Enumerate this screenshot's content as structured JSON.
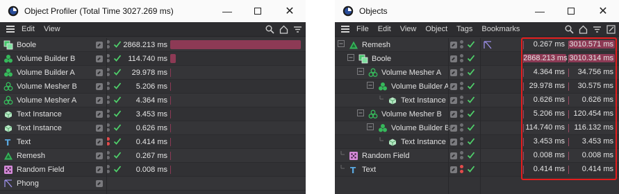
{
  "profiler": {
    "title": "Object Profiler (Total Time 3027.269 ms)",
    "menu": [
      "Edit",
      "View"
    ],
    "total_ms": 3027.269,
    "rows": [
      {
        "name": "Boole",
        "icon": "boole-icon",
        "time": "2868.213 ms",
        "ms": 2868.213,
        "dots": "grey"
      },
      {
        "name": "Volume Builder B",
        "icon": "volume-builder-icon",
        "time": "114.740 ms",
        "ms": 114.74,
        "dots": "grey"
      },
      {
        "name": "Volume Builder A",
        "icon": "volume-builder-icon",
        "time": "29.978 ms",
        "ms": 29.978,
        "dots": "grey"
      },
      {
        "name": "Volume Mesher  B",
        "icon": "volume-mesher-icon",
        "time": "5.206 ms",
        "ms": 5.206,
        "dots": "grey"
      },
      {
        "name": "Volume Mesher A",
        "icon": "volume-mesher-icon",
        "time": "4.364 ms",
        "ms": 4.364,
        "dots": "grey"
      },
      {
        "name": "Text Instance",
        "icon": "instance-icon",
        "time": "3.453 ms",
        "ms": 3.453,
        "dots": "grey"
      },
      {
        "name": "Text Instance",
        "icon": "instance-icon",
        "time": "0.626 ms",
        "ms": 0.626,
        "dots": "grey"
      },
      {
        "name": "Text",
        "icon": "text-spline-icon",
        "time": "0.414 ms",
        "ms": 0.414,
        "dots": "red"
      },
      {
        "name": "Remesh",
        "icon": "remesh-icon",
        "time": "0.267 ms",
        "ms": 0.267,
        "dots": "grey"
      },
      {
        "name": "Random Field",
        "icon": "random-field-icon",
        "time": "0.008 ms",
        "ms": 0.008,
        "dots": "grey"
      },
      {
        "name": "Phong",
        "icon": "phong-tag-icon",
        "time": "",
        "ms": 0,
        "dots": "none"
      }
    ]
  },
  "objects": {
    "title": "Objects",
    "menu": [
      "File",
      "Edit",
      "View",
      "Object",
      "Tags",
      "Bookmarks"
    ],
    "rows": [
      {
        "name": "Remesh",
        "icon": "remesh-icon",
        "depth": 0,
        "expand": "−",
        "tag": "phong-tag-icon",
        "self": "0.267 ms",
        "total": "3010.571 ms",
        "self_hl": false,
        "total_hl": true,
        "dots": "grey"
      },
      {
        "name": "Boole",
        "icon": "boole-icon",
        "depth": 1,
        "expand": "−",
        "tag": "",
        "self": "2868.213 ms",
        "total": "3010.314 ms",
        "self_hl": true,
        "total_hl": true,
        "dots": "grey"
      },
      {
        "name": "Volume Mesher A",
        "icon": "volume-mesher-icon",
        "depth": 2,
        "expand": "−",
        "tag": "",
        "self": "4.364 ms",
        "total": "34.756 ms",
        "self_hl": false,
        "total_hl": false,
        "dots": "grey"
      },
      {
        "name": "Volume Builder A",
        "icon": "volume-builder-icon",
        "depth": 3,
        "expand": "−",
        "tag": "",
        "self": "29.978 ms",
        "total": "30.575 ms",
        "self_hl": false,
        "total_hl": false,
        "dots": "grey"
      },
      {
        "name": "Text Instance",
        "icon": "instance-icon",
        "depth": 4,
        "expand": "",
        "tag": "",
        "self": "0.626 ms",
        "total": "0.626 ms",
        "self_hl": false,
        "total_hl": false,
        "dots": "grey"
      },
      {
        "name": "Volume Mesher  B",
        "icon": "volume-mesher-icon",
        "depth": 2,
        "expand": "−",
        "tag": "",
        "self": "5.206 ms",
        "total": "120.454 ms",
        "self_hl": false,
        "total_hl": false,
        "dots": "grey"
      },
      {
        "name": "Volume Builder B",
        "icon": "volume-builder-icon",
        "depth": 3,
        "expand": "−",
        "tag": "",
        "self": "114.740 ms",
        "total": "116.132 ms",
        "self_hl": false,
        "total_hl": false,
        "dots": "grey"
      },
      {
        "name": "Text Instance",
        "icon": "instance-icon",
        "depth": 4,
        "expand": "",
        "tag": "",
        "self": "3.453 ms",
        "total": "3.453 ms",
        "self_hl": false,
        "total_hl": false,
        "dots": "grey"
      },
      {
        "name": "Random Field",
        "icon": "random-field-icon",
        "depth": 0,
        "expand": "",
        "tag": "",
        "self": "0.008 ms",
        "total": "0.008 ms",
        "self_hl": false,
        "total_hl": false,
        "dots": "grey"
      },
      {
        "name": "Text",
        "icon": "text-spline-icon",
        "depth": 0,
        "expand": "",
        "tag": "",
        "self": "0.414 ms",
        "total": "0.414 ms",
        "self_hl": false,
        "total_hl": false,
        "dots": "red"
      }
    ]
  },
  "colors": {
    "bar": "#8d3a55",
    "check": "#4fd06a",
    "dot_red": "#e24b4b",
    "highlight_box": "#e51d1d"
  }
}
